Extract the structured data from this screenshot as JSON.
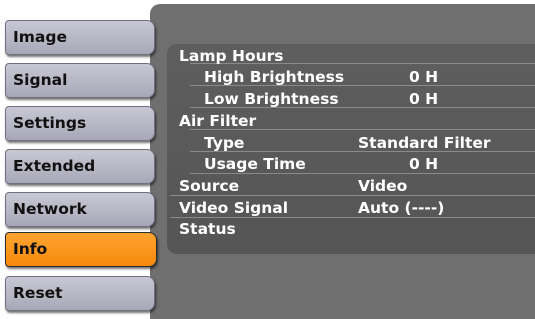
{
  "sidebar": {
    "tabs": [
      {
        "label": "Image"
      },
      {
        "label": "Signal"
      },
      {
        "label": "Settings"
      },
      {
        "label": "Extended"
      },
      {
        "label": "Network"
      },
      {
        "label": "Info"
      },
      {
        "label": "Reset"
      }
    ],
    "active_tab": "Info"
  },
  "info": {
    "lamp_hours": {
      "label": "Lamp Hours",
      "high_brightness": {
        "label": "High Brightness",
        "value": "0 H"
      },
      "low_brightness": {
        "label": "Low Brightness",
        "value": "0 H"
      }
    },
    "air_filter": {
      "label": "Air Filter",
      "type": {
        "label": "Type",
        "value": "Standard Filter"
      },
      "usage_time": {
        "label": "Usage Time",
        "value": "0 H"
      }
    },
    "source": {
      "label": "Source",
      "value": "Video"
    },
    "video_signal": {
      "label": "Video Signal",
      "value": "Auto (----)"
    },
    "status": {
      "label": "Status"
    }
  },
  "colors": {
    "active_tab": "#f7890c",
    "inactive_tab": "#b4b4c4",
    "content_bg": "#6f6f6f",
    "text": "#ffffff"
  }
}
